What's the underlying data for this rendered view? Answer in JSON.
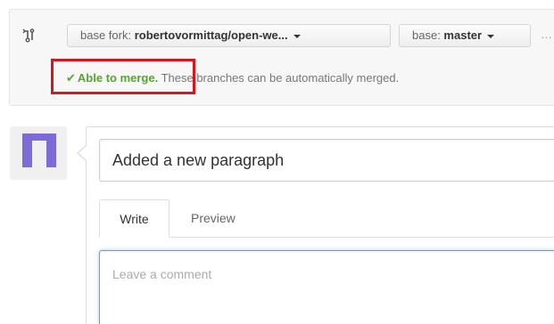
{
  "compare": {
    "base_fork_prefix": "base fork: ",
    "base_fork_value": "robertovormittag/open-we...",
    "base_prefix": "base: ",
    "base_value": "master",
    "overflow_dots": "…"
  },
  "merge_status": {
    "check": "✔",
    "status_label": "Able to merge.",
    "message": " These branches can be automatically merged.",
    "status_color": "#55a532"
  },
  "comment_form": {
    "title_value": "Added a new paragraph",
    "tabs": [
      {
        "label": "Write",
        "selected": true
      },
      {
        "label": "Preview",
        "selected": false
      }
    ],
    "comment_placeholder": "Leave a comment"
  },
  "icons": {
    "compare": "git-compare-icon",
    "avatar": "identicon-avatar",
    "dropdown": "caret-down-icon"
  },
  "colors": {
    "highlight": "#d9141c",
    "avatar": "#7f6bd6",
    "focus": "#51a7e8"
  }
}
